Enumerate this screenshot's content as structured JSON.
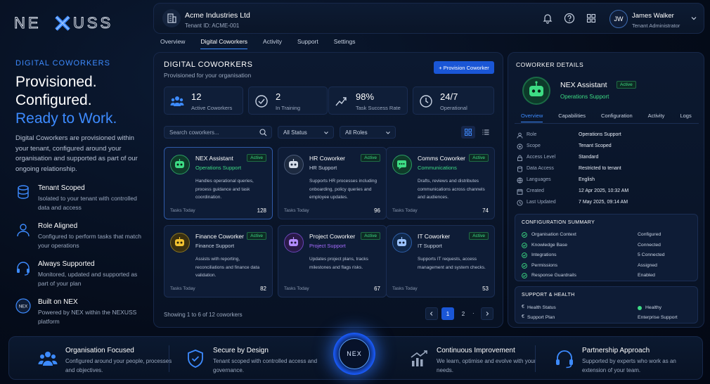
{
  "brand": {
    "logo_text": "NEXUSS",
    "accent": "#3d8bff",
    "success": "#3ddc84"
  },
  "hero": {
    "kicker": "DIGITAL COWORKERS",
    "line1": "Provisioned.",
    "line2": "Configured.",
    "line3": "Ready to Work.",
    "description": "Digital Coworkers are provisioned within your tenant, configured around your organisation and supported as part of our ongoing relationship.",
    "features": [
      {
        "icon": "database-icon",
        "title": "Tenant Scoped",
        "desc": "Isolated to your tenant with controlled data and access"
      },
      {
        "icon": "person-icon",
        "title": "Role Aligned",
        "desc": "Configured to perform tasks that match your operations"
      },
      {
        "icon": "headset-icon",
        "title": "Always Supported",
        "desc": "Monitored, updated and supported as part of your plan"
      },
      {
        "icon": "nex-icon",
        "title": "Built on NEX",
        "desc": "Powered by NEX within the NEXUSS platform"
      }
    ]
  },
  "topbar": {
    "tenant_name": "Acme Industries Ltd",
    "tenant_id": "Tenant ID: ACME-001",
    "user_initials": "JW",
    "user_name": "James Walker",
    "user_role": "Tenant Administrator"
  },
  "tabs": [
    "Overview",
    "Digital Coworkers",
    "Activity",
    "Support",
    "Settings"
  ],
  "active_tab": "Digital Coworkers",
  "main": {
    "title": "DIGITAL COWORKERS",
    "subtitle": "Provisioned for your organisation",
    "provision_label": "+ Provision Coworker",
    "stats": [
      {
        "icon": "users-icon",
        "value": "12",
        "label": "Active Coworkers"
      },
      {
        "icon": "check-circle-icon",
        "value": "2",
        "label": "In Training"
      },
      {
        "icon": "trend-icon",
        "value": "98%",
        "label": "Task Success Rate"
      },
      {
        "icon": "clock-icon",
        "value": "24/7",
        "label": "Operational"
      }
    ],
    "search_placeholder": "Search coworkers...",
    "status_filter": "All Status",
    "roles_filter": "All Roles",
    "cards": [
      {
        "name": "NEX Assistant",
        "role": "Operations Support",
        "badge": "Active",
        "desc": "Handles operational queries, process guidance and task coordination.",
        "tasks_label": "Tasks Today",
        "tasks": "128",
        "color": "#3ddc84"
      },
      {
        "name": "HR Coworker",
        "role": "HR Support",
        "badge": "Active",
        "desc": "Supports HR processes including onboarding, policy queries and employee updates.",
        "tasks_label": "Tasks Today",
        "tasks": "96",
        "color": "#c9d3e3"
      },
      {
        "name": "Comms Coworker",
        "role": "Communications",
        "badge": "Active",
        "desc": "Drafts, reviews and distributes communications across channels and audiences.",
        "tasks_label": "Tasks Today",
        "tasks": "74",
        "color": "#3ddc84"
      },
      {
        "name": "Finance Coworker",
        "role": "Finance Support",
        "badge": "Active",
        "desc": "Assists with reporting, reconciliations and finance data validation.",
        "tasks_label": "Tasks Today",
        "tasks": "82",
        "color": "#f2c230"
      },
      {
        "name": "Project Coworker",
        "role": "Project Support",
        "badge": "Active",
        "desc": "Updates project plans, tracks milestones and flags risks.",
        "tasks_label": "Tasks Today",
        "tasks": "67",
        "color": "#a66bff"
      },
      {
        "name": "IT Coworker",
        "role": "IT Support",
        "badge": "Active",
        "desc": "Supports IT requests, access management and system checks.",
        "tasks_label": "Tasks Today",
        "tasks": "53",
        "color": "#3d8bff"
      }
    ],
    "showing": "Showing 1 to 6 of 12 coworkers",
    "pages": [
      "1",
      "2"
    ],
    "current_page": "1"
  },
  "detail": {
    "title": "COWORKER DETAILS",
    "name": "NEX Assistant",
    "badge": "Active",
    "role": "Operations Support",
    "tabs": [
      "Overview",
      "Capabilities",
      "Configuration",
      "Activity",
      "Logs"
    ],
    "fields": [
      {
        "icon": "person-icon",
        "key": "Role",
        "value": "Operations Support"
      },
      {
        "icon": "target-icon",
        "key": "Scope",
        "value": "Tenant Scoped"
      },
      {
        "icon": "lock-icon",
        "key": "Access Level",
        "value": "Standard"
      },
      {
        "icon": "database-icon",
        "key": "Data Access",
        "value": "Restricted to tenant"
      },
      {
        "icon": "globe-icon",
        "key": "Languages",
        "value": "English"
      },
      {
        "icon": "calendar-icon",
        "key": "Created",
        "value": "12 Apr 2025, 10:32 AM"
      },
      {
        "icon": "clock-icon",
        "key": "Last Updated",
        "value": "7 May 2025, 09:14 AM"
      }
    ],
    "config_title": "CONFIGURATION SUMMARY",
    "config": [
      {
        "label": "Organisation Context",
        "value": "Configured"
      },
      {
        "label": "Knowledge Base",
        "value": "Connected"
      },
      {
        "label": "Integrations",
        "value": "5 Connected"
      },
      {
        "label": "Permissions",
        "value": "Assigned"
      },
      {
        "label": "Response Guardrails",
        "value": "Enabled"
      }
    ],
    "support_title": "SUPPORT & HEALTH",
    "support": [
      {
        "label": "Health Status",
        "value": "Healthy"
      },
      {
        "label": "Support Plan",
        "value": "Enterprise Support"
      }
    ]
  },
  "bottom": {
    "orb_text": "NEX",
    "items": [
      {
        "icon": "people-group-icon",
        "title": "Organisation Focused",
        "desc": "Configured around your people, processes and objectives."
      },
      {
        "icon": "shield-icon",
        "title": "Secure by Design",
        "desc": "Tenant scoped with controlled access and governance."
      },
      {
        "icon": "growth-icon",
        "title": "Continuous Improvement",
        "desc": "We learn, optimise and evolve with your needs."
      },
      {
        "icon": "headset-icon",
        "title": "Partnership Approach",
        "desc": "Supported by experts who work as an extension of your team."
      }
    ]
  }
}
